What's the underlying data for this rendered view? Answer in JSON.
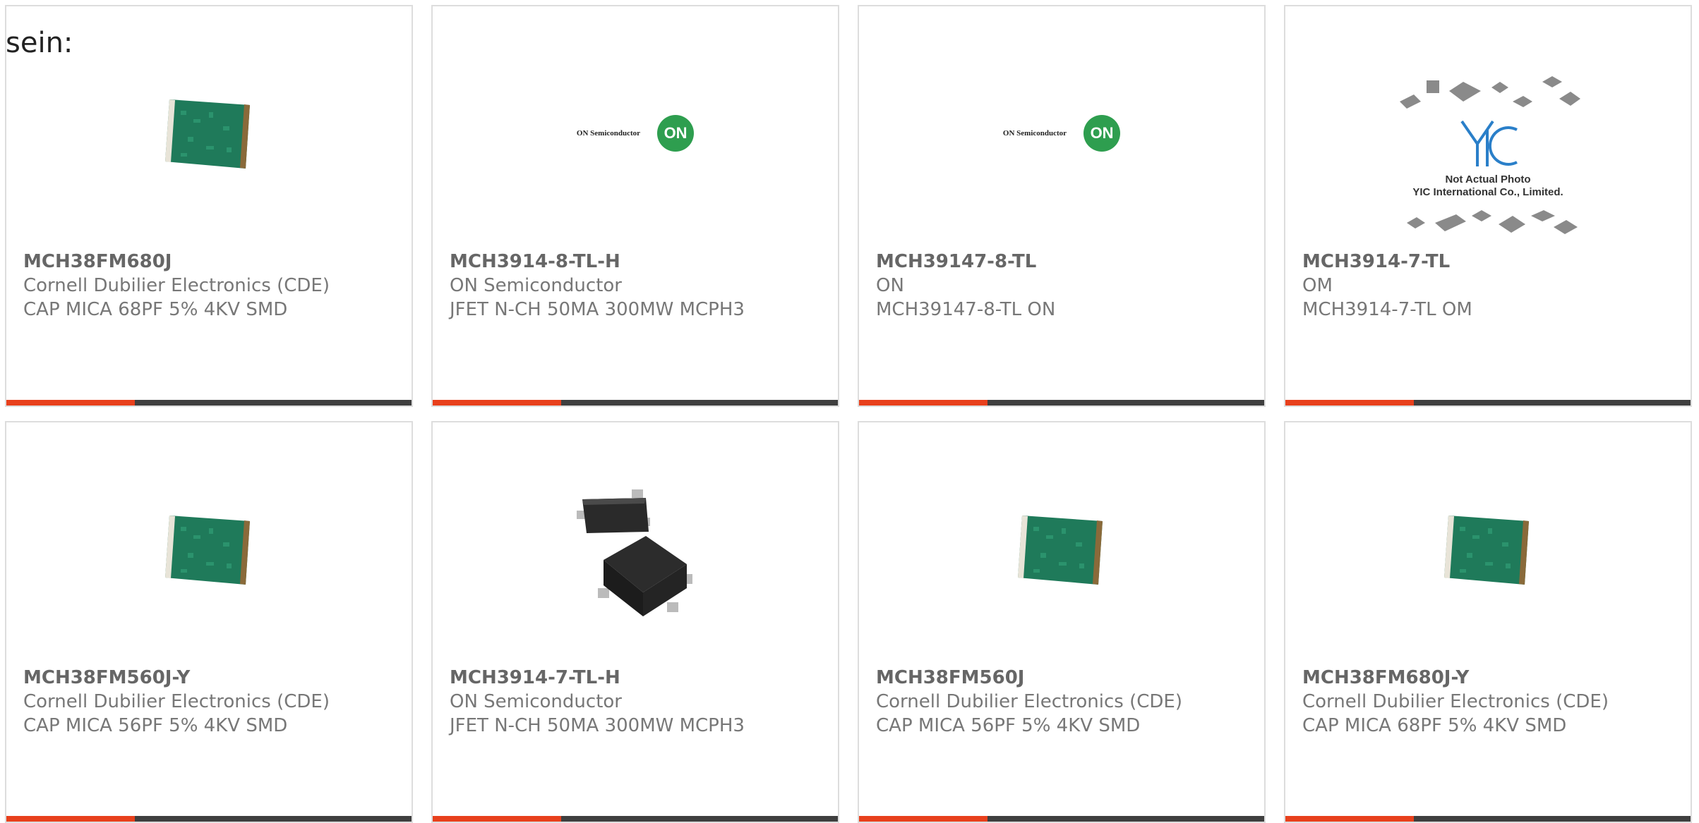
{
  "page": {
    "heading": "sein:"
  },
  "cards": [
    {
      "part_number": "MCH38FM680J",
      "manufacturer": "Cornell Dubilier Electronics (CDE)",
      "description": "CAP MICA 68PF 5% 4KV SMD",
      "image": "mica-capacitor-image"
    },
    {
      "part_number": "MCH3914-8-TL-H",
      "manufacturer": "ON Semiconductor",
      "description": "JFET N-CH 50MA 300MW MCPH3",
      "image": "on-semiconductor-logo",
      "logo_text": "ON Semiconductor",
      "logo_badge": "ON"
    },
    {
      "part_number": "MCH39147-8-TL",
      "manufacturer": "ON",
      "description": "MCH39147-8-TL ON",
      "image": "on-semiconductor-logo",
      "logo_text": "ON Semiconductor",
      "logo_badge": "ON"
    },
    {
      "part_number": "MCH3914-7-TL",
      "manufacturer": "OM",
      "description": "MCH3914-7-TL OM",
      "image": "yic-placeholder-image",
      "placeholder_line1": "Not Actual Photo",
      "placeholder_line2": "YIC International Co., Limited."
    },
    {
      "part_number": "MCH38FM560J-Y",
      "manufacturer": "Cornell Dubilier Electronics (CDE)",
      "description": "CAP MICA 56PF 5% 4KV SMD",
      "image": "mica-capacitor-image"
    },
    {
      "part_number": "MCH3914-7-TL-H",
      "manufacturer": "ON Semiconductor",
      "description": "JFET N-CH 50MA 300MW MCPH3",
      "image": "smd-transistor-image"
    },
    {
      "part_number": "MCH38FM560J",
      "manufacturer": "Cornell Dubilier Electronics (CDE)",
      "description": "CAP MICA 56PF 5% 4KV SMD",
      "image": "mica-capacitor-image"
    },
    {
      "part_number": "MCH38FM680J-Y",
      "manufacturer": "Cornell Dubilier Electronics (CDE)",
      "description": "CAP MICA 68PF 5% 4KV SMD",
      "image": "mica-capacitor-image"
    }
  ],
  "colors": {
    "accent": "#e8401c",
    "bar": "#3f3f3f",
    "border": "#dddddd",
    "text": "#777777",
    "on_logo_green": "#2e9e4f",
    "yic_blue": "#2a7fc9"
  }
}
